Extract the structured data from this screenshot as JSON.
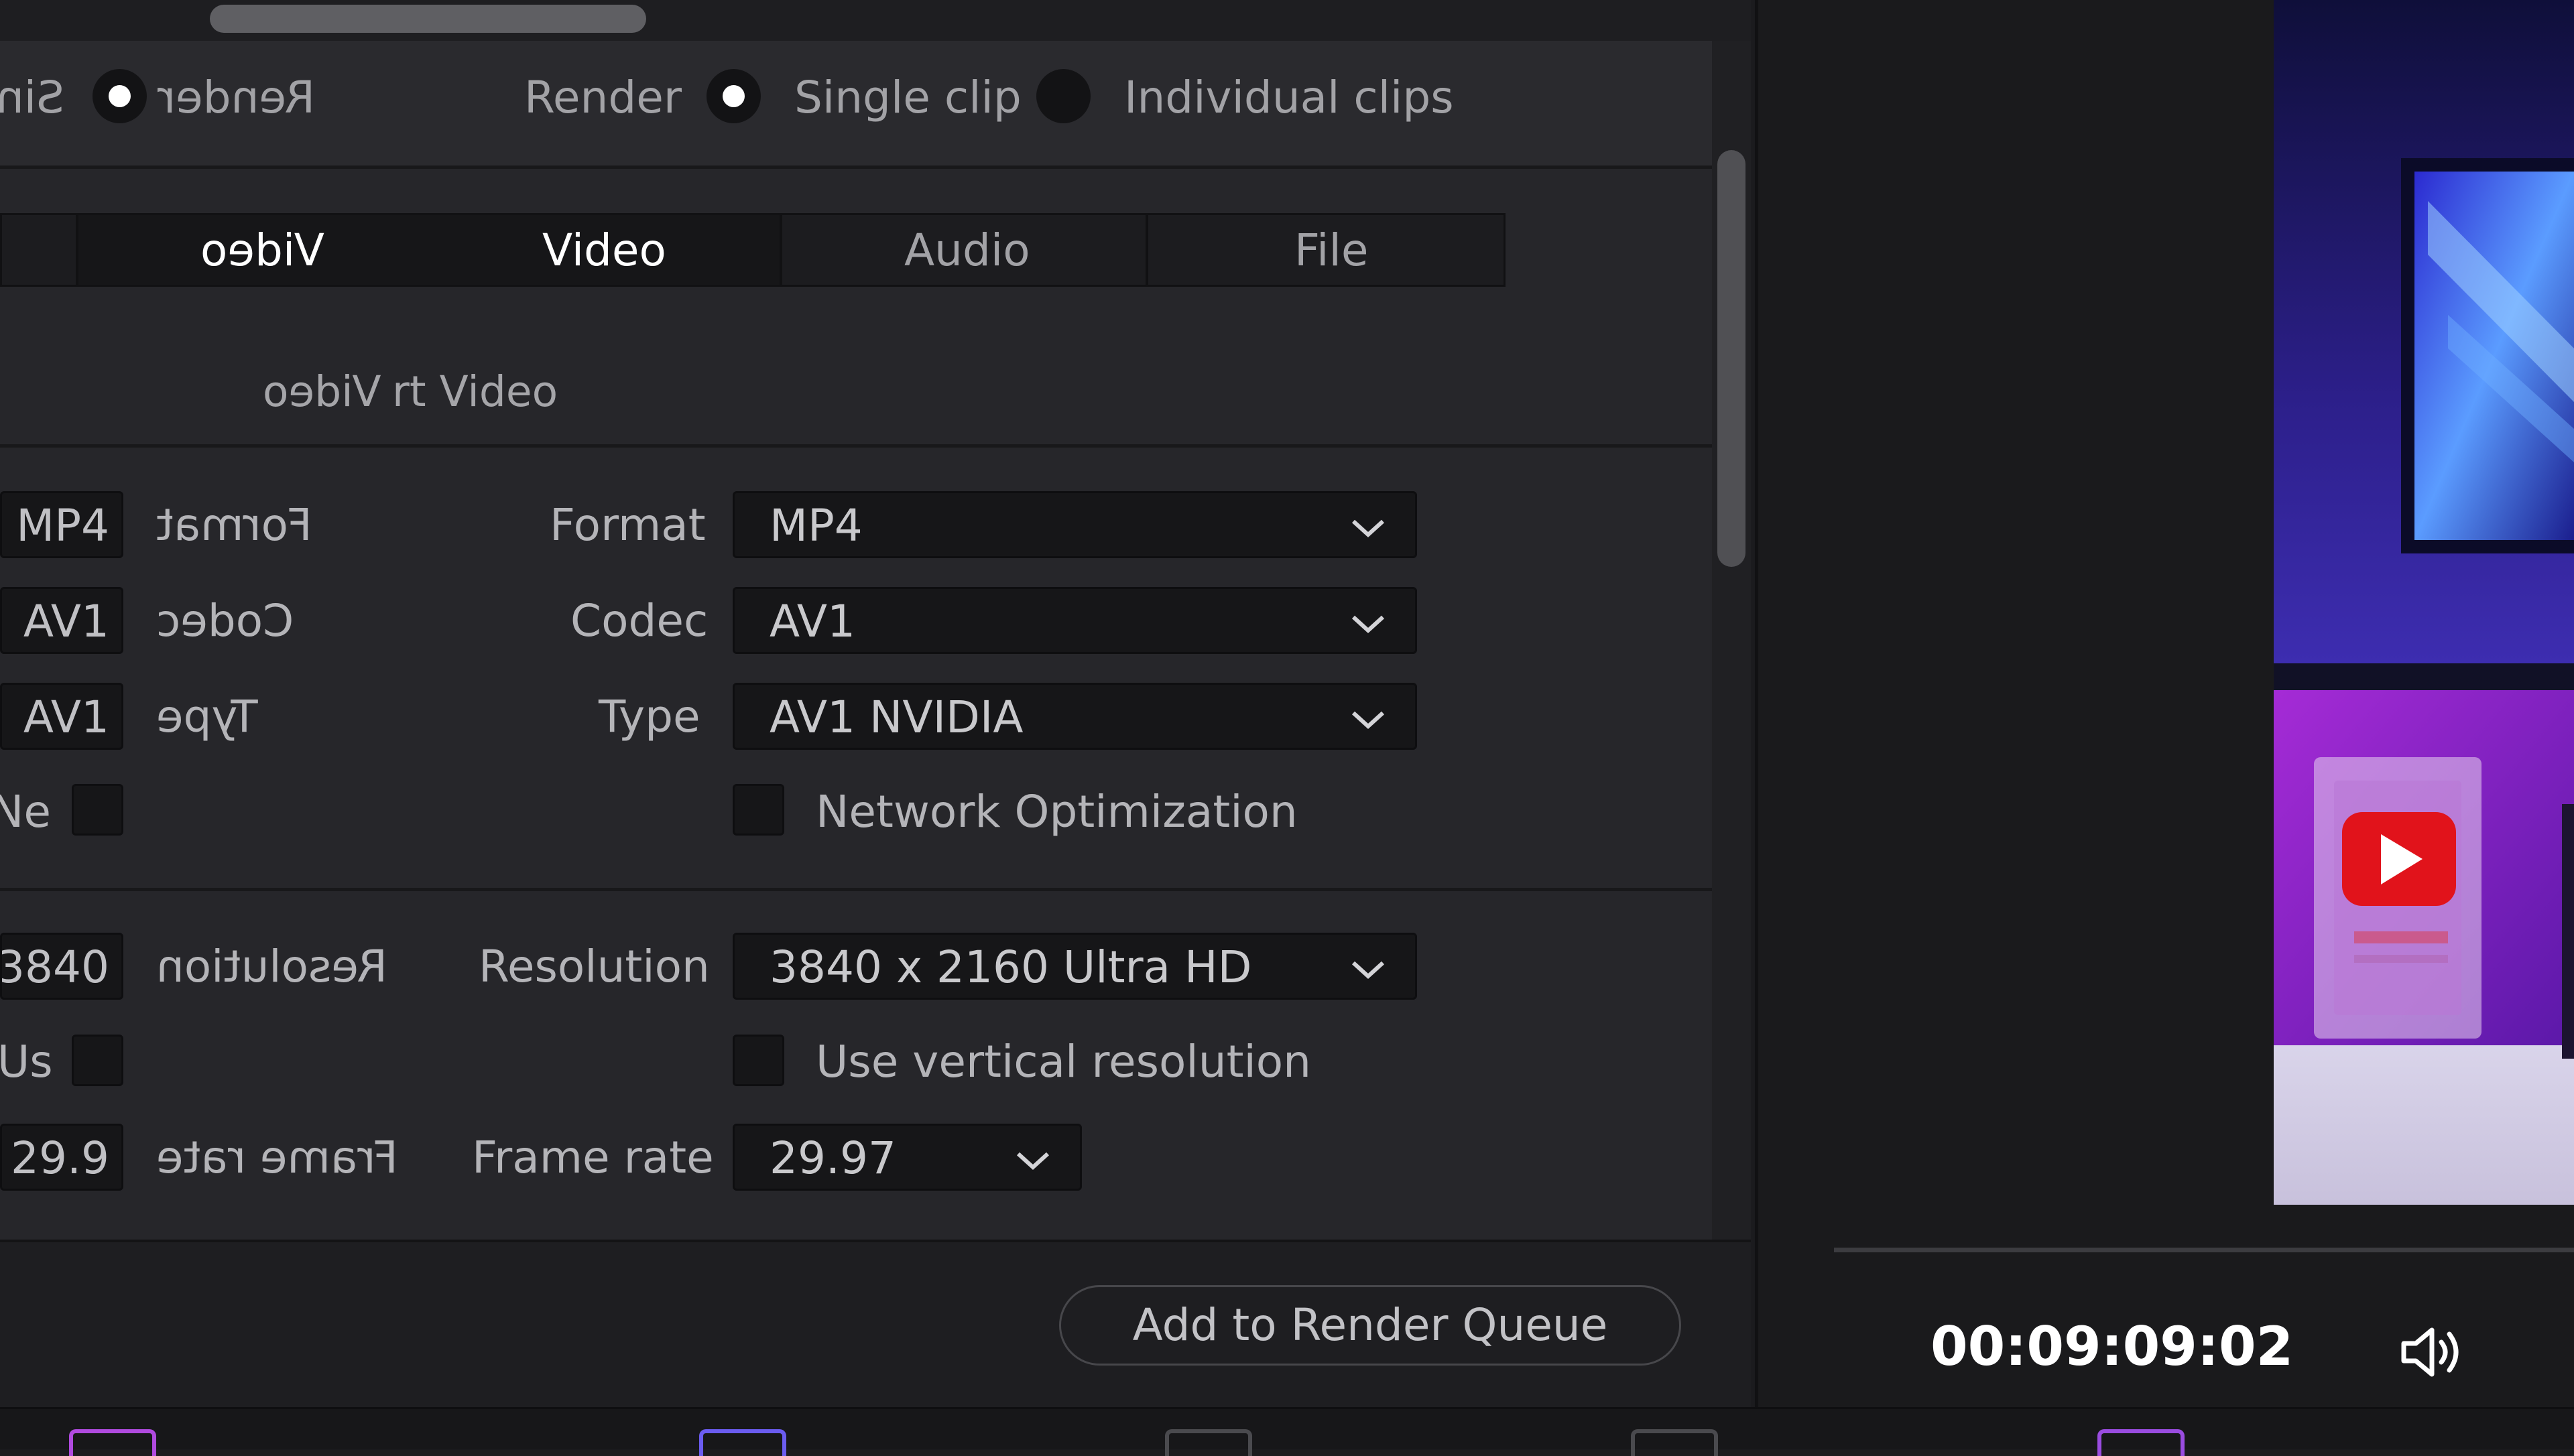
{
  "render_mode": {
    "label": "Render",
    "label_mirrored": "Render",
    "options": [
      {
        "label": "Single clip",
        "selected": true
      },
      {
        "label": "Individual clips",
        "selected": false
      }
    ],
    "mirror_fragment": "Sin"
  },
  "tabs": [
    {
      "label": "Video",
      "active": true
    },
    {
      "label": "Audio",
      "active": false
    },
    {
      "label": "File",
      "active": false
    }
  ],
  "tabs_mirror": {
    "label": "Video"
  },
  "section": {
    "title_mirrored": "Video",
    "title_fragment": "rt Video"
  },
  "form": {
    "format": {
      "label": "Format",
      "value": "MP4",
      "stub": "MP4"
    },
    "codec": {
      "label": "Codec",
      "value": "AV1",
      "stub": "AV1"
    },
    "type": {
      "label": "Type",
      "value": "AV1 NVIDIA",
      "stub": "AV1"
    },
    "network_optimization": {
      "label": "Network Optimization",
      "checked": false,
      "stub": "Ne"
    },
    "resolution": {
      "label": "Resolution",
      "value": "3840 x 2160 Ultra HD",
      "stub": "3840"
    },
    "vertical_resolution": {
      "label": "Use vertical resolution",
      "checked": false,
      "stub": "Us"
    },
    "frame_rate": {
      "label": "Frame rate",
      "value": "29.97",
      "stub": "29.9"
    }
  },
  "actions": {
    "add_to_queue": "Add to Render Queue"
  },
  "viewer": {
    "timecode": "00:09:09:02"
  },
  "colors": {
    "panel": "#26262a",
    "accent_purple": "#b04adf",
    "accent_blue": "#6b5cf0",
    "neutral_icon": "#4a4a4e"
  },
  "page_icons": [
    "media-page-icon",
    "cut-page-icon",
    "edit-page-icon",
    "fusion-page-icon",
    "deliver-page-icon"
  ]
}
